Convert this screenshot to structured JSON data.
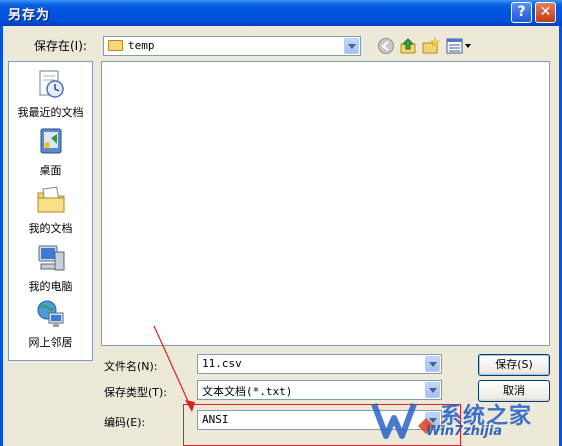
{
  "window": {
    "title": "另存为",
    "help_glyph": "?",
    "close_glyph": "✕"
  },
  "save_in": {
    "label": "保存在(I):",
    "value": "temp"
  },
  "places": [
    {
      "label": "我最近的文档",
      "icon": "recent-documents-icon"
    },
    {
      "label": "桌面",
      "icon": "desktop-icon"
    },
    {
      "label": "我的文档",
      "icon": "my-documents-icon"
    },
    {
      "label": "我的电脑",
      "icon": "my-computer-icon"
    },
    {
      "label": "网上邻居",
      "icon": "network-places-icon"
    }
  ],
  "file_name": {
    "label": "文件名(N):",
    "value": "11.csv"
  },
  "file_type": {
    "label": "保存类型(T):",
    "value": "文本文档(*.txt)"
  },
  "encoding": {
    "label": "编码(E):",
    "value": "ANSI"
  },
  "buttons": {
    "save": "保存(S)",
    "cancel": "取消"
  },
  "watermark": {
    "line1": "系统之家",
    "line2": "Win7zhijia"
  },
  "colors": {
    "titlebar": "#0054E3",
    "face": "#ECE9D8",
    "annotation": "#E02020"
  }
}
